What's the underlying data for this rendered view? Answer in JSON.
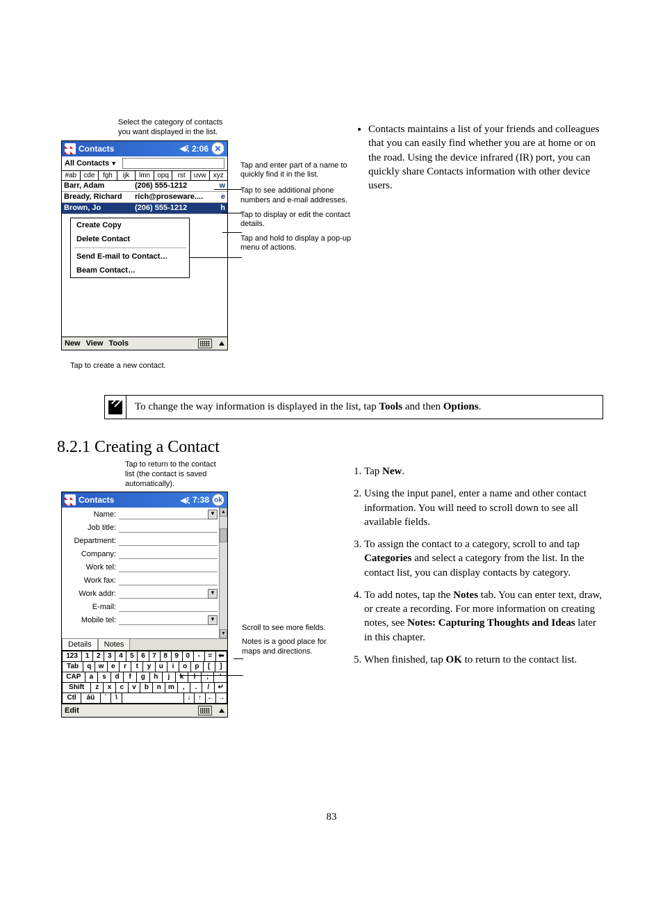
{
  "intro_bullet": "Contacts maintains a list of your friends and colleagues that you can easily find whether you are at home or on the road. Using the device infrared (IR) port, you can quickly share Contacts information with other device users.",
  "fig1": {
    "caption_top": "Select the category of contacts you want displayed in the list.",
    "callouts": {
      "search": "Tap and enter part of a name to quickly find it in the list.",
      "phone": "Tap to see additional phone numbers and e-mail addresses.",
      "detail": "Tap to display or edit the contact details.",
      "hold": "Tap and hold to display a pop-up menu of actions."
    },
    "caption_bottom": "Tap to create a new contact.",
    "title": "Contacts",
    "time": "2:06",
    "filter": "All Contacts",
    "alpha": [
      "#ab",
      "cde",
      "fgh",
      "ijk",
      "lmn",
      "opq",
      "rst",
      "uvw",
      "xyz"
    ],
    "rows": [
      {
        "name": "Barr, Adam",
        "value": "(206) 555-1212",
        "tag": "w"
      },
      {
        "name": "Bready, Richard",
        "value": "rich@proseware....",
        "tag": "e"
      },
      {
        "name": "Brown, Jo",
        "value": "(206) 555-1212",
        "tag": "h"
      }
    ],
    "context_menu": [
      "Create Copy",
      "Delete Contact",
      "—",
      "Send E-mail to Contact…",
      "Beam Contact…"
    ],
    "menubar": [
      "New",
      "View",
      "Tools"
    ]
  },
  "note": {
    "pre": "To change the way information is displayed in the list, tap ",
    "b1": "Tools",
    "mid": " and then ",
    "b2": "Options",
    "post": "."
  },
  "heading": "8.2.1 Creating a Contact",
  "fig2": {
    "caption_top": "Tap to return to the contact list (the contact is saved automatically).",
    "callouts": {
      "scroll": "Scroll to see more fields.",
      "notes": "Notes is a good place for maps and directions."
    },
    "title": "Contacts",
    "time": "7:38",
    "fields": [
      "Name:",
      "Job title:",
      "Department:",
      "Company:",
      "Work tel:",
      "Work fax:",
      "Work addr:",
      "E-mail:",
      "Mobile tel:"
    ],
    "tabs": [
      "Details",
      "Notes"
    ],
    "menubar": [
      "Edit"
    ],
    "osk": {
      "r1": [
        "123",
        "1",
        "2",
        "3",
        "4",
        "5",
        "6",
        "7",
        "8",
        "9",
        "0",
        "-",
        "=",
        "⬅"
      ],
      "r2": [
        "Tab",
        "q",
        "w",
        "e",
        "r",
        "t",
        "y",
        "u",
        "i",
        "o",
        "p",
        "[",
        "]"
      ],
      "r3": [
        "CAP",
        "a",
        "s",
        "d",
        "f",
        "g",
        "h",
        "j",
        "k",
        "l",
        ";",
        "'"
      ],
      "r4": [
        "Shift",
        "z",
        "x",
        "c",
        "v",
        "b",
        "n",
        "m",
        ",",
        ".",
        "/",
        "↵"
      ],
      "r5": [
        "Ctl",
        "áü",
        "`",
        "\\",
        " ",
        "↓",
        "↑",
        "←",
        "→"
      ]
    }
  },
  "steps": [
    {
      "pre": "Tap ",
      "b": "New",
      "post": "."
    },
    {
      "text": "Using the input panel, enter a name and other contact information. You will need to scroll down to see all available fields."
    },
    {
      "pre": "To assign the contact to a category, scroll to and tap ",
      "b": "Categories",
      "post": " and select a category from the list. In the contact list, you can display contacts by category."
    },
    {
      "pre": "To add notes, tap the ",
      "b": "Notes",
      "mid": " tab. You can enter text, draw, or create a recording. For more information on creating notes, see ",
      "b2": "Notes: Capturing Thoughts and Ideas",
      "post": " later in this chapter."
    },
    {
      "pre": "When finished, tap ",
      "b": "OK",
      "post": " to return to the contact list."
    }
  ],
  "page_number": "83"
}
